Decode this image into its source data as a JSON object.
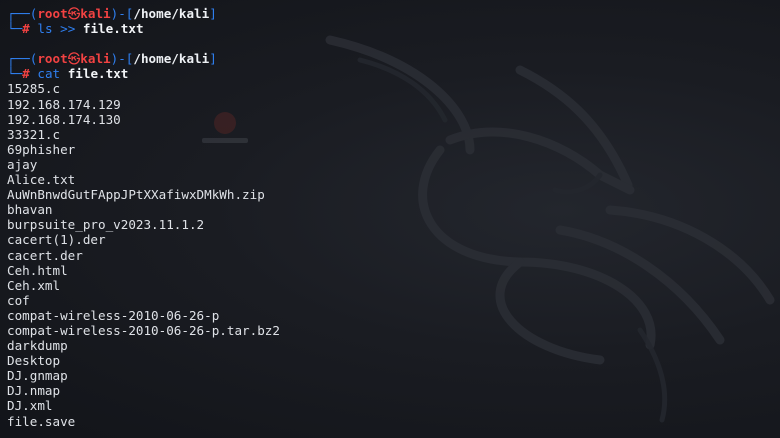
{
  "colors": {
    "background": "#16181e",
    "prompt_box": "#2f7ff0",
    "prompt_user": "#f14242",
    "prompt_path": "#eef1f5",
    "command": "#2f7ff0",
    "output_text": "#dfe2e7"
  },
  "prompt": {
    "top_left": "┌──(",
    "user": "root",
    "at_symbol": "㉿",
    "host": "kali",
    "middle": ")-[",
    "path": "/home/kali",
    "close": "]",
    "bottom_left": "└─",
    "hash": "#"
  },
  "commands": [
    {
      "cmd": "ls",
      "operator": ">>",
      "arg": "file.txt"
    },
    {
      "cmd": "cat",
      "operator": "",
      "arg": "file.txt"
    }
  ],
  "output_lines": [
    "15285.c",
    "192.168.174.129",
    "192.168.174.130",
    "33321.c",
    "69phisher",
    "ajay",
    "Alice.txt",
    "AuWnBnwdGutFAppJPtXXafiwxDMkWh.zip",
    "bhavan",
    "burpsuite_pro_v2023.11.1.2",
    "cacert(1).der",
    "cacert.der",
    "Ceh.html",
    "Ceh.xml",
    "cof",
    "compat-wireless-2010-06-26-p",
    "compat-wireless-2010-06-26-p.tar.bz2",
    "darkdump",
    "Desktop",
    "DJ.gnmap",
    "DJ.nmap",
    "DJ.xml",
    "file.save"
  ],
  "wallpaper": {
    "logo_icon": "kali-dragon-icon",
    "desktop_icon": "desktop-app-icon"
  }
}
